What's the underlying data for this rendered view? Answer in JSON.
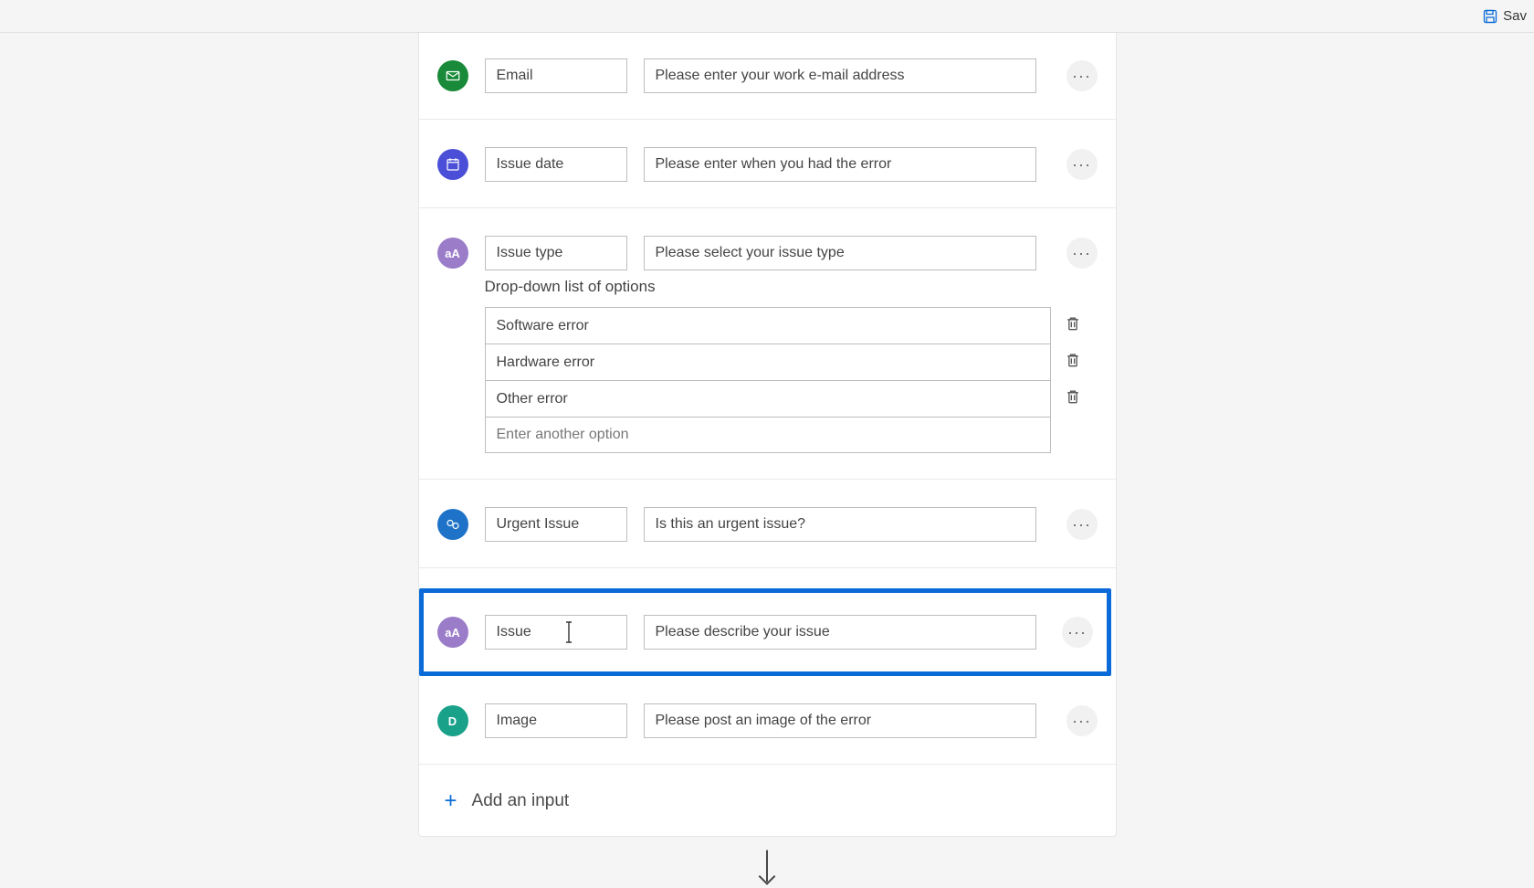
{
  "toolbar": {
    "save_label": "Sav"
  },
  "fields": {
    "email": {
      "name": "Email",
      "desc": "Please enter your work e-mail address"
    },
    "date": {
      "name": "Issue date",
      "desc": "Please enter when you had the error"
    },
    "type": {
      "name": "Issue type",
      "desc": "Please select your issue type"
    },
    "urgent": {
      "name": "Urgent Issue",
      "desc": "Is this an urgent issue?"
    },
    "issue": {
      "name": "Issue",
      "desc": "Please describe your issue"
    },
    "image": {
      "name": "Image",
      "desc": "Please post an image of the error"
    }
  },
  "dropdown": {
    "label": "Drop-down list of options",
    "options": [
      "Software error",
      "Hardware error",
      "Other error"
    ],
    "new_option_placeholder": "Enter another option"
  },
  "add_input_label": "Add an input",
  "icon_text_label": "aA",
  "icon_file_label": "D"
}
